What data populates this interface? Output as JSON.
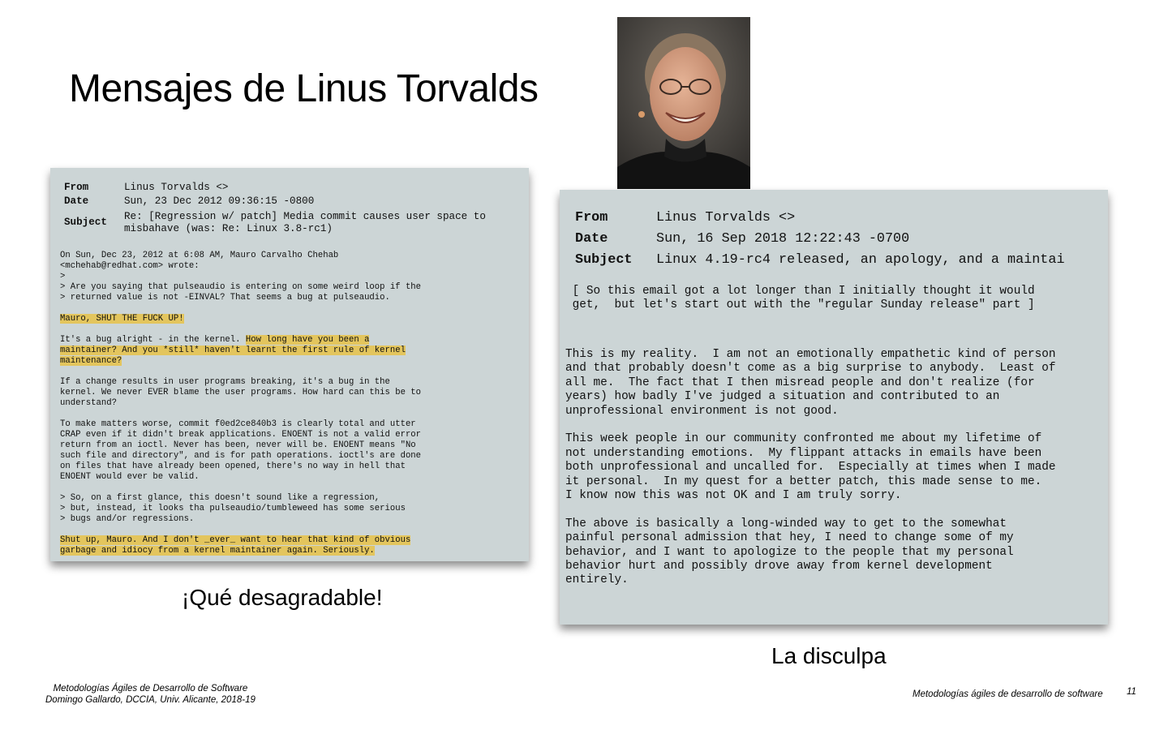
{
  "slide": {
    "title": "Mensajes de Linus Torvalds",
    "caption_left": "¡Qué desagradable!",
    "caption_right": "La disculpa"
  },
  "email_left": {
    "headers": [
      {
        "key": "From",
        "value": "Linus Torvalds <>"
      },
      {
        "key": "Date",
        "value": "Sun, 23 Dec 2012 09:36:15 -0800"
      },
      {
        "key": "Subject",
        "value": "Re: [Regression w/ patch] Media commit causes user space to\nmisbahave (was: Re: Linux 3.8-rc1)"
      }
    ],
    "paragraphs": [
      [
        {
          "text": "On Sun, Dec 23, 2012 at 6:08 AM, Mauro Carvalho Chehab\n<mchehab@redhat.com> wrote:\n>\n> Are you saying that pulseaudio is entering on some weird loop if the\n> returned value is not -EINVAL? That seems a bug at pulseaudio.",
          "hl": false
        }
      ],
      [
        {
          "text": "Mauro, SHUT THE FUCK UP!",
          "hl": true
        }
      ],
      [
        {
          "text": "It's a bug alright - in the kernel. ",
          "hl": false
        },
        {
          "text": "How long have you been a\nmaintainer? And you *still* haven't learnt the first rule of kernel\nmaintenance?",
          "hl": true
        }
      ],
      [
        {
          "text": "If a change results in user programs breaking, it's a bug in the\nkernel. We never EVER blame the user programs. How hard can this be to\nunderstand?",
          "hl": false
        }
      ],
      [
        {
          "text": "To make matters worse, commit f0ed2ce840b3 is clearly total and utter\nCRAP even if it didn't break applications. ENOENT is not a valid error\nreturn from an ioctl. Never has been, never will be. ENOENT means \"No\nsuch file and directory\", and is for path operations. ioctl's are done\non files that have already been opened, there's no way in hell that\nENOENT would ever be valid.",
          "hl": false
        }
      ],
      [
        {
          "text": "> So, on a first glance, this doesn't sound like a regression,\n> but, instead, it looks tha pulseaudio/tumbleweed has some serious\n> bugs and/or regressions.",
          "hl": false
        }
      ],
      [
        {
          "text": "Shut up, Mauro. And I don't _ever_ want to hear that kind of obvious\ngarbage and idiocy from a kernel maintainer again. Seriously.",
          "hl": true
        }
      ]
    ]
  },
  "email_right": {
    "headers": [
      {
        "key": "From",
        "value": "Linus Torvalds <>"
      },
      {
        "key": "Date",
        "value": "Sun, 16 Sep 2018 12:22:43 -0700"
      },
      {
        "key": "Subject",
        "value": "Linux 4.19-rc4 released, an apology, and a maintai"
      }
    ],
    "intro": " [ So this email got a lot longer than I initially thought it would\n get,  but let's start out with the \"regular Sunday release\" part ]",
    "paragraphs": [
      "This is my reality.  I am not an emotionally empathetic kind of person\nand that probably doesn't come as a big surprise to anybody.  Least of\nall me.  The fact that I then misread people and don't realize (for\nyears) how badly I've judged a situation and contributed to an\nunprofessional environment is not good.",
      "This week people in our community confronted me about my lifetime of\nnot understanding emotions.  My flippant attacks in emails have been\nboth unprofessional and uncalled for.  Especially at times when I made\nit personal.  In my quest for a better patch, this made sense to me.\nI know now this was not OK and I am truly sorry.",
      "The above is basically a long-winded way to get to the somewhat\npainful personal admission that hey, I need to change some of my\nbehavior, and I want to apologize to the people that my personal\nbehavior hurt and possibly drove away from kernel development\nentirely."
    ]
  },
  "footer": {
    "left_line1": "Metodologías Ágiles de Desarrollo de Software",
    "left_line2": "Domingo Gallardo, DCCIA, Univ. Alicante, 2018-19",
    "right": "Metodologías ágiles de desarrollo de software",
    "page_number": "11"
  },
  "colors": {
    "card_background": "#ccd5d6",
    "highlight": "#e3c55d"
  }
}
